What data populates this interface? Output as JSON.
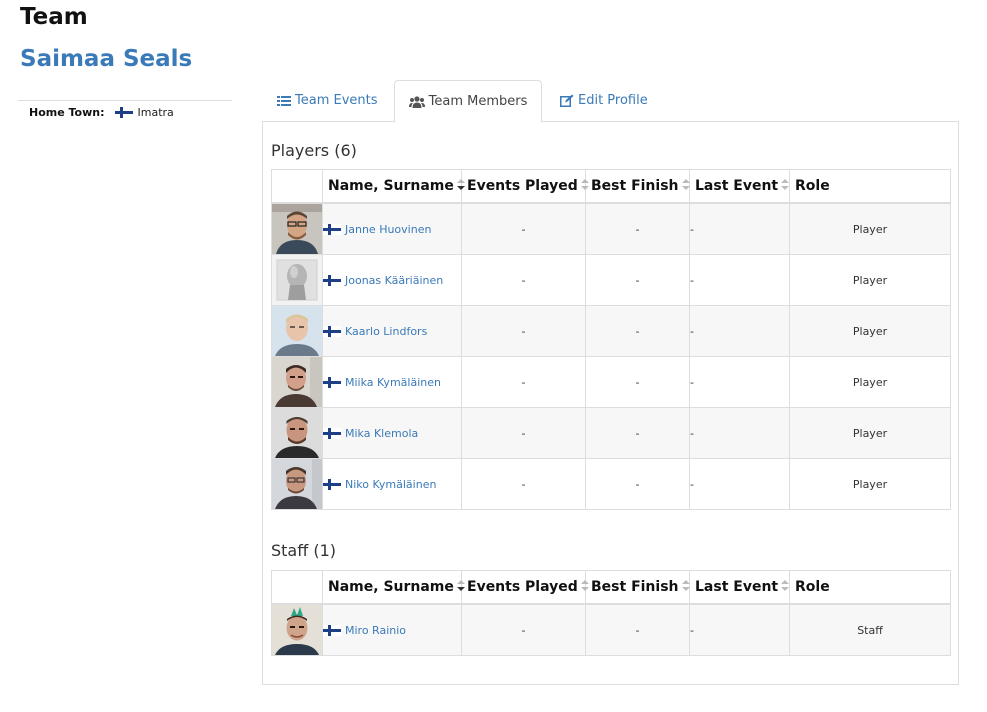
{
  "page": {
    "title": "Team"
  },
  "team": {
    "name": "Saimaa Seals",
    "home_town_label": "Home Town:",
    "home_town": "Imatra"
  },
  "tabs": [
    {
      "label": "Team Events",
      "icon": "list-icon",
      "active": false
    },
    {
      "label": "Team Members",
      "icon": "users-icon",
      "active": true
    },
    {
      "label": "Edit Profile",
      "icon": "edit-icon",
      "active": false
    }
  ],
  "players": {
    "title": "Players (6)",
    "columns": [
      "Name, Surname",
      "Events Played",
      "Best Finish",
      "Last Event",
      "Role"
    ],
    "rows": [
      {
        "name": "Janne Huovinen",
        "events_played": "-",
        "best_finish": "-",
        "last_event": "-",
        "role": "Player"
      },
      {
        "name": "Joonas Kääriäinen",
        "events_played": "-",
        "best_finish": "-",
        "last_event": "-",
        "role": "Player"
      },
      {
        "name": "Kaarlo Lindfors",
        "events_played": "-",
        "best_finish": "-",
        "last_event": "-",
        "role": "Player"
      },
      {
        "name": "Miika Kymäläinen",
        "events_played": "-",
        "best_finish": "-",
        "last_event": "-",
        "role": "Player"
      },
      {
        "name": "Mika Klemola",
        "events_played": "-",
        "best_finish": "-",
        "last_event": "-",
        "role": "Player"
      },
      {
        "name": "Niko Kymäläinen",
        "events_played": "-",
        "best_finish": "-",
        "last_event": "-",
        "role": "Player"
      }
    ]
  },
  "staff": {
    "title": "Staff (1)",
    "columns": [
      "Name, Surname",
      "Events Played",
      "Best Finish",
      "Last Event",
      "Role"
    ],
    "rows": [
      {
        "name": "Miro Rainio",
        "events_played": "-",
        "best_finish": "-",
        "last_event": "-",
        "role": "Staff"
      }
    ]
  },
  "colors": {
    "link": "#3a7ab8",
    "flag_blue": "#1d3f86",
    "border": "#dddddd",
    "stripe": "#f7f7f7"
  }
}
